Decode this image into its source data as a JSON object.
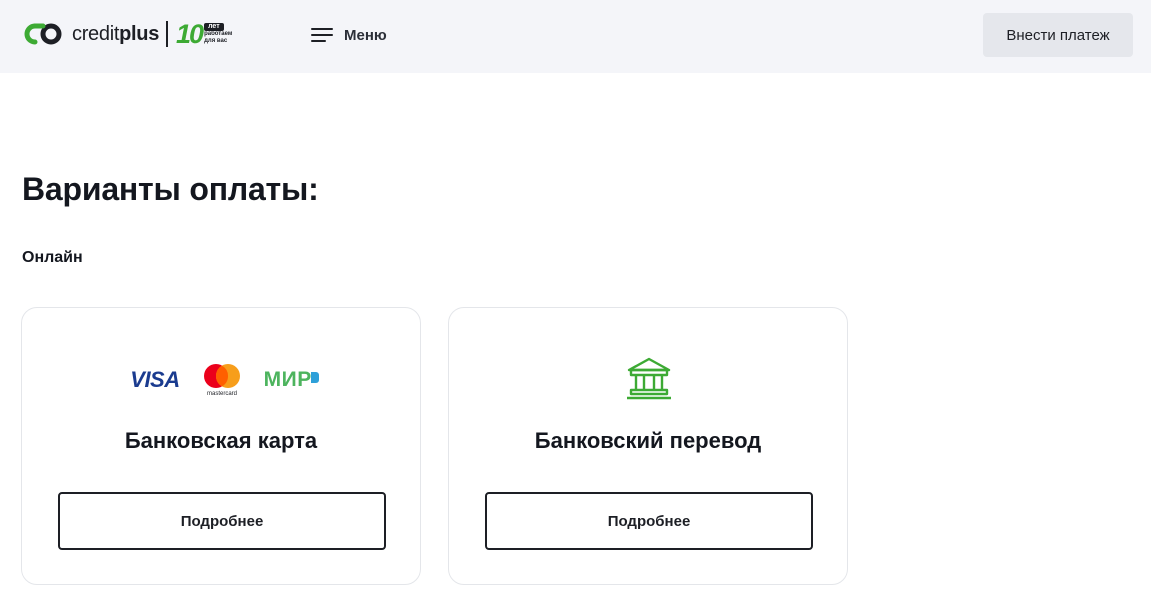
{
  "header": {
    "logo": {
      "brand": "creditplus",
      "brand_part1": "credit",
      "brand_part2": "plus",
      "anniversary_number": "10",
      "anniversary_unit": "лет",
      "anniversary_caption_line1": "работаем",
      "anniversary_caption_line2": "для вас",
      "accent_color": "#3daa34"
    },
    "menu_label": "Меню",
    "menu_icon": "hamburger-icon",
    "pay_button_label": "Внести платеж"
  },
  "main": {
    "title": "Варианты оплаты:",
    "section_label": "Онлайн",
    "cards": [
      {
        "title": "Банковская карта",
        "logos": [
          "visa-logo",
          "mastercard-logo",
          "mir-logo"
        ],
        "visa_text": "VISA",
        "mastercard_text": "mastercard",
        "mir_text": "МИР",
        "button_label": "Подробнее"
      },
      {
        "title": "Банковский перевод",
        "icon": "bank-building-icon",
        "icon_color": "#3daa34",
        "button_label": "Подробнее"
      }
    ]
  }
}
